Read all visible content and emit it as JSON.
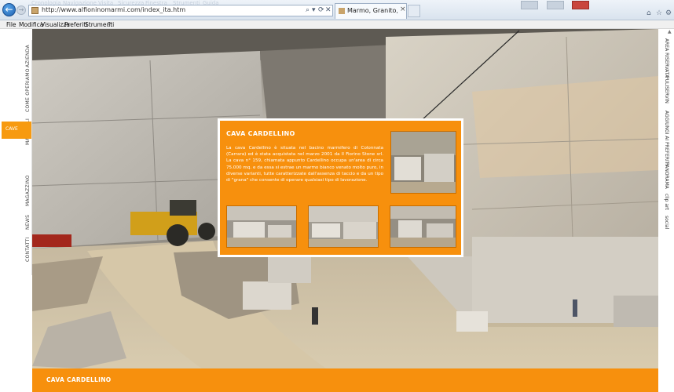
{
  "browser": {
    "back_glyph": "←",
    "forward_glyph": "→",
    "url": "http://www.alfioninomarmi.com/index_ita.htm",
    "tab_title": "Marmo, Granito, Travertino...",
    "tab_close": "×",
    "address_controls": [
      "⌕",
      "▾",
      "⟳",
      "✕"
    ],
    "faint_menu": [
      "Cronologia",
      "Navigazione",
      "Visita",
      "Sicurezza",
      "Finestra",
      "Strumenti",
      "Guida"
    ],
    "tools": [
      "⌂",
      "☆",
      "⚙"
    ],
    "window_controls": [
      "minimize",
      "maximize",
      "close"
    ]
  },
  "menubar": {
    "items": [
      "File",
      "Modifica",
      "Visualizza",
      "Preferiti",
      "Strumenti",
      "?"
    ]
  },
  "left_nav": {
    "items": [
      "AZIENDA",
      "COME OPERIAMO",
      "MATERIALI",
      "CAVE",
      "MAGAZZINO",
      "NEWS",
      "CONTATTI"
    ],
    "active": "CAVE"
  },
  "right_nav": {
    "items": [
      "AREA RISERVATA",
      "PULISERVIN",
      "AGGIUNGI AI PREFERITI",
      "PANORAMA",
      "clip art",
      "social"
    ]
  },
  "info_box": {
    "title": "CAVA CARDELLINO",
    "text": "La cava Cardellino è situata nel bacino marmifero di Colonnata (Carrara) ed è stata acquistata nel marzo 2001 da Il Fiorino Stone srl. La cava n° 159, chiamata appunto Cardellino occupa un'area di circa 75.000 mq. e da essa si estrae un marmo bianco venato molto puro, in diverse varianti, tutte caratterizzate dall'assenza di taccio e da un tipo di \"grana\" che consente di operare qualsiasi tipo di lavorazione."
  },
  "footer": {
    "title": "CAVA CARDELLINO"
  },
  "colors": {
    "accent_orange": "#f7900d",
    "browser_blue": "#1d5fae"
  }
}
